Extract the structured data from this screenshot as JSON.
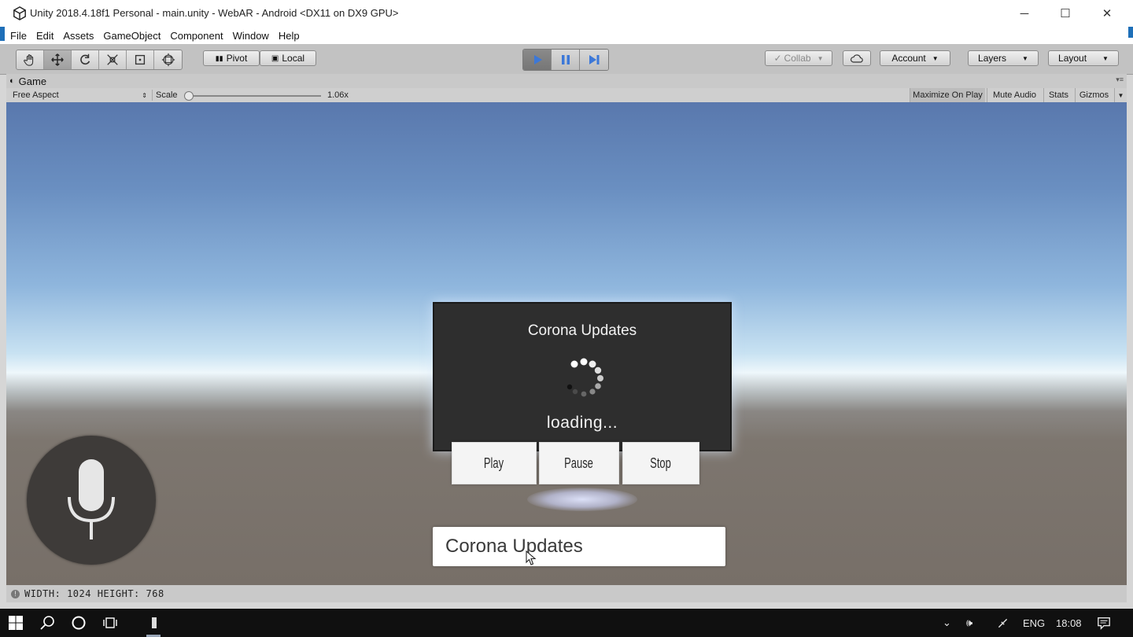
{
  "window": {
    "title": "Unity 2018.4.18f1 Personal - main.unity - WebAR - Android <DX11 on DX9 GPU>",
    "controls": {
      "minimize": "─",
      "maximize": "☐",
      "close": "✕"
    }
  },
  "menu": [
    "File",
    "Edit",
    "Assets",
    "GameObject",
    "Component",
    "Window",
    "Help"
  ],
  "toolbar": {
    "tools": [
      "hand-tool",
      "move-tool",
      "rotate-tool",
      "scale-tool",
      "rect-tool",
      "transform-tool"
    ],
    "pivot_label": "Pivot",
    "local_label": "Local",
    "collab_label": "Collab",
    "account_label": "Account",
    "layers_label": "Layers",
    "layout_label": "Layout",
    "playing": true
  },
  "game_panel": {
    "tab_label": "Game",
    "aspect": "Free Aspect",
    "scale_label": "Scale",
    "scale_value": "1.06x",
    "toggles": [
      "Maximize On Play",
      "Mute Audio",
      "Stats",
      "Gizmos"
    ],
    "status": "WIDTH: 1024 HEIGHT: 768"
  },
  "scene": {
    "screen_title": "Corona Updates",
    "loading_text": "loading...",
    "buttons": {
      "play": "Play",
      "pause": "Pause",
      "stop": "Stop"
    },
    "query_text": "Corona Updates",
    "mic_icon": "microphone-icon"
  },
  "taskbar": {
    "language": "ENG",
    "time": "18:08"
  },
  "colors": {
    "play_active": "#3c78d8",
    "sky_top": "#5978ad",
    "ground": "#776f68",
    "screen_bg": "#2e2e2e"
  }
}
